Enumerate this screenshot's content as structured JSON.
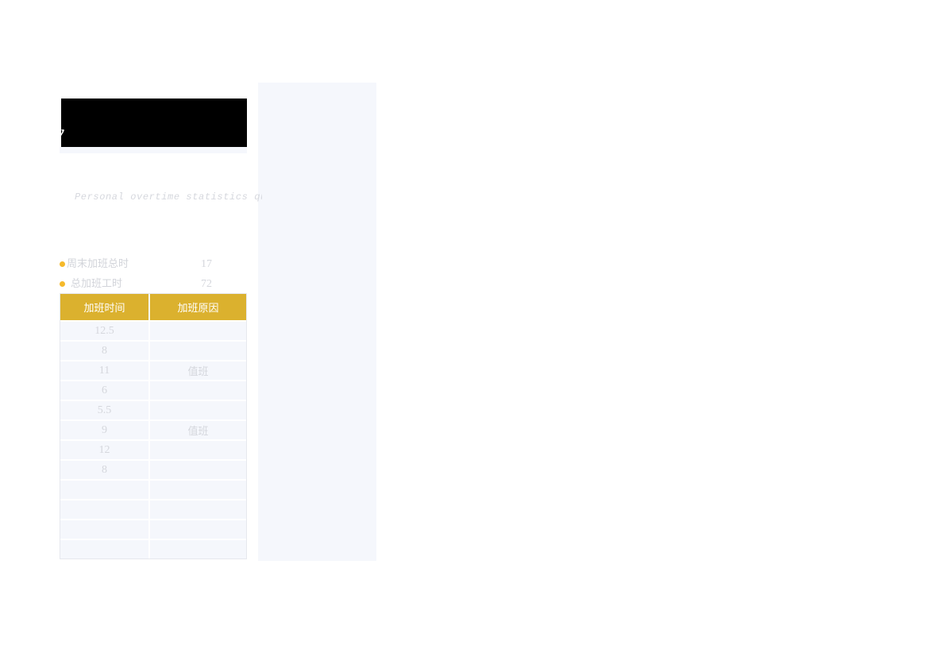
{
  "page": {
    "background_color": "#ffffff",
    "panel_color": "#f5f7fc",
    "card_color": "#ffffff",
    "accent_color": "#dbb12e",
    "bullet_color": "#f5b92b",
    "muted_text_color": "#d5d7dd"
  },
  "hero": {
    "title": "ry",
    "banner_color": "#000000"
  },
  "subtitle": {
    "text": "Personal overtime statistics qu"
  },
  "summary": {
    "rows": [
      {
        "label": "周末加班总时",
        "value": "17"
      },
      {
        "label": "总加班工时",
        "value": "72"
      }
    ]
  },
  "table": {
    "headers": [
      "加班时间",
      "加班原因"
    ],
    "rows": [
      {
        "hours": "12.5",
        "reason": ""
      },
      {
        "hours": "8",
        "reason": ""
      },
      {
        "hours": "11",
        "reason": "值班"
      },
      {
        "hours": "6",
        "reason": ""
      },
      {
        "hours": "5.5",
        "reason": ""
      },
      {
        "hours": "9",
        "reason": "值班"
      },
      {
        "hours": "12",
        "reason": ""
      },
      {
        "hours": "8",
        "reason": ""
      },
      {
        "hours": "",
        "reason": ""
      },
      {
        "hours": "",
        "reason": ""
      },
      {
        "hours": "",
        "reason": ""
      },
      {
        "hours": "",
        "reason": ""
      }
    ]
  }
}
